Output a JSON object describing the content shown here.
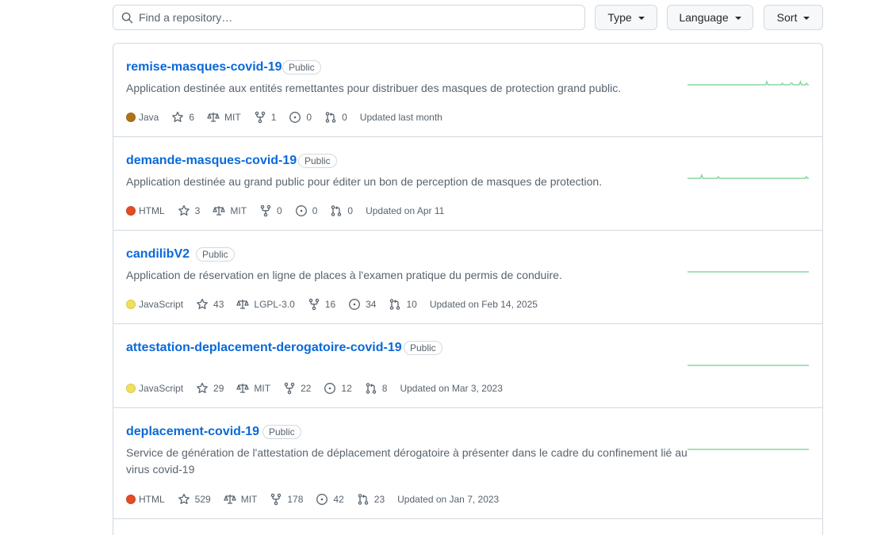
{
  "search": {
    "placeholder": "Find a repository…"
  },
  "filters": {
    "type_label": "Type",
    "language_label": "Language",
    "sort_label": "Sort"
  },
  "colors": {
    "link": "#0969da",
    "sparkline": "#87d7a0",
    "Java": "#b07219",
    "HTML": "#e34c26",
    "JavaScript": "#f1e05a"
  },
  "repos": [
    {
      "name": "remise-masques-covid-19",
      "visibility": "Public",
      "description": "Application destinée aux entités remettantes pour distribuer des masques de protection grand public.",
      "language": "Java",
      "stars": "6",
      "license": "MIT",
      "forks": "1",
      "issues": "0",
      "pulls": "0",
      "updated": "Updated last month",
      "activity": [
        0,
        0,
        0,
        0,
        0,
        0,
        0,
        0,
        0,
        0,
        0,
        0,
        0,
        0,
        0,
        0,
        0,
        0,
        0,
        0,
        0,
        0,
        0,
        0,
        0,
        0,
        0,
        0,
        0,
        0,
        0,
        0,
        0,
        0,
        0,
        0,
        0,
        0,
        0,
        0,
        0,
        0,
        0,
        0,
        0,
        0,
        0,
        0,
        0,
        0,
        0,
        0,
        0,
        0,
        0,
        0,
        0,
        0,
        0,
        0,
        0,
        0,
        0,
        0,
        0,
        0,
        2,
        0,
        0,
        0,
        0,
        0,
        0,
        0,
        0,
        0,
        0,
        0,
        0,
        1,
        0,
        0,
        0,
        0,
        0,
        0,
        1,
        1,
        0,
        0,
        0,
        0,
        0,
        0,
        2,
        0,
        0,
        0,
        0,
        1,
        0,
        0
      ]
    },
    {
      "name": "demande-masques-covid-19",
      "visibility": "Public",
      "description": "Application destinée au grand public pour éditer un bon de perception de masques de protection.",
      "language": "HTML",
      "stars": "3",
      "license": "MIT",
      "forks": "0",
      "issues": "0",
      "pulls": "0",
      "updated": "Updated on Apr 11",
      "activity": [
        0,
        0,
        0,
        0,
        0,
        0,
        0,
        0,
        0,
        0,
        0,
        0,
        2,
        0,
        0,
        0,
        0,
        0,
        0,
        0,
        0,
        0,
        0,
        0,
        0,
        0,
        1,
        0,
        0,
        0,
        0,
        0,
        0,
        0,
        0,
        0,
        0,
        0,
        0,
        0,
        0,
        0,
        0,
        0,
        0,
        0,
        0,
        0,
        0,
        0,
        0,
        0,
        0,
        0,
        0,
        0,
        0,
        0,
        0,
        0,
        0,
        0,
        0,
        0,
        0,
        0,
        0,
        0,
        0,
        0,
        0,
        0,
        0,
        0,
        0,
        0,
        0,
        0,
        0,
        0,
        0,
        0,
        0,
        0,
        0,
        0,
        0,
        0,
        0,
        0,
        0,
        0,
        0,
        0,
        0,
        0,
        0,
        0,
        0,
        0,
        1,
        0,
        0
      ]
    },
    {
      "name": "candilibV2",
      "visibility": "Public",
      "description": "Application de réservation en ligne de places à l'examen pratique du permis de conduire.",
      "language": "JavaScript",
      "stars": "43",
      "license": "LGPL-3.0",
      "forks": "16",
      "issues": "34",
      "pulls": "10",
      "updated": "Updated on Feb 14, 2025",
      "activity": [
        0,
        0,
        0,
        0,
        0,
        0,
        0,
        0,
        0,
        0,
        0,
        0,
        0,
        0,
        0,
        0,
        0,
        0,
        0,
        0
      ]
    },
    {
      "name": "attestation-deplacement-derogatoire-covid-19",
      "visibility": "Public",
      "description": "",
      "language": "JavaScript",
      "stars": "29",
      "license": "MIT",
      "forks": "22",
      "issues": "12",
      "pulls": "8",
      "updated": "Updated on Mar 3, 2023",
      "activity": [
        0,
        0,
        0,
        0,
        0,
        0,
        0,
        0,
        0,
        0,
        0,
        0,
        0,
        0,
        0,
        0,
        0,
        0,
        0,
        0
      ]
    },
    {
      "name": "deplacement-covid-19",
      "visibility": "Public",
      "description": "Service de génération de l'attestation de déplacement dérogatoire à présenter dans le cadre du confinement lié au virus covid-19",
      "language": "HTML",
      "stars": "529",
      "license": "MIT",
      "forks": "178",
      "issues": "42",
      "pulls": "23",
      "updated": "Updated on Jan 7, 2023",
      "activity": [
        0,
        0,
        0,
        0,
        0,
        0,
        0,
        0,
        0,
        0,
        0,
        0,
        0,
        0,
        0,
        0,
        0,
        0,
        0,
        0
      ]
    }
  ]
}
